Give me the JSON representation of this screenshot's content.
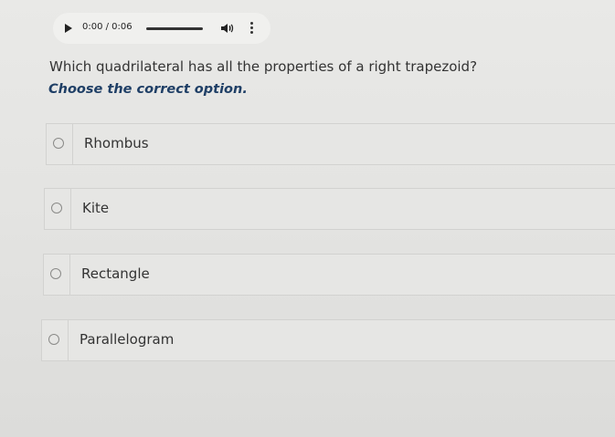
{
  "audio_player": {
    "time": "0:00 / 0:06",
    "play_icon": "play-icon",
    "volume_icon": "speaker-icon",
    "menu_icon": "more-vertical-icon"
  },
  "question": {
    "text": "Which quadrilateral has all the properties of a right trapezoid?",
    "instruction": "Choose the correct option."
  },
  "options": [
    {
      "label": "Rhombus"
    },
    {
      "label": "Kite"
    },
    {
      "label": "Rectangle"
    },
    {
      "label": "Parallelogram"
    }
  ]
}
